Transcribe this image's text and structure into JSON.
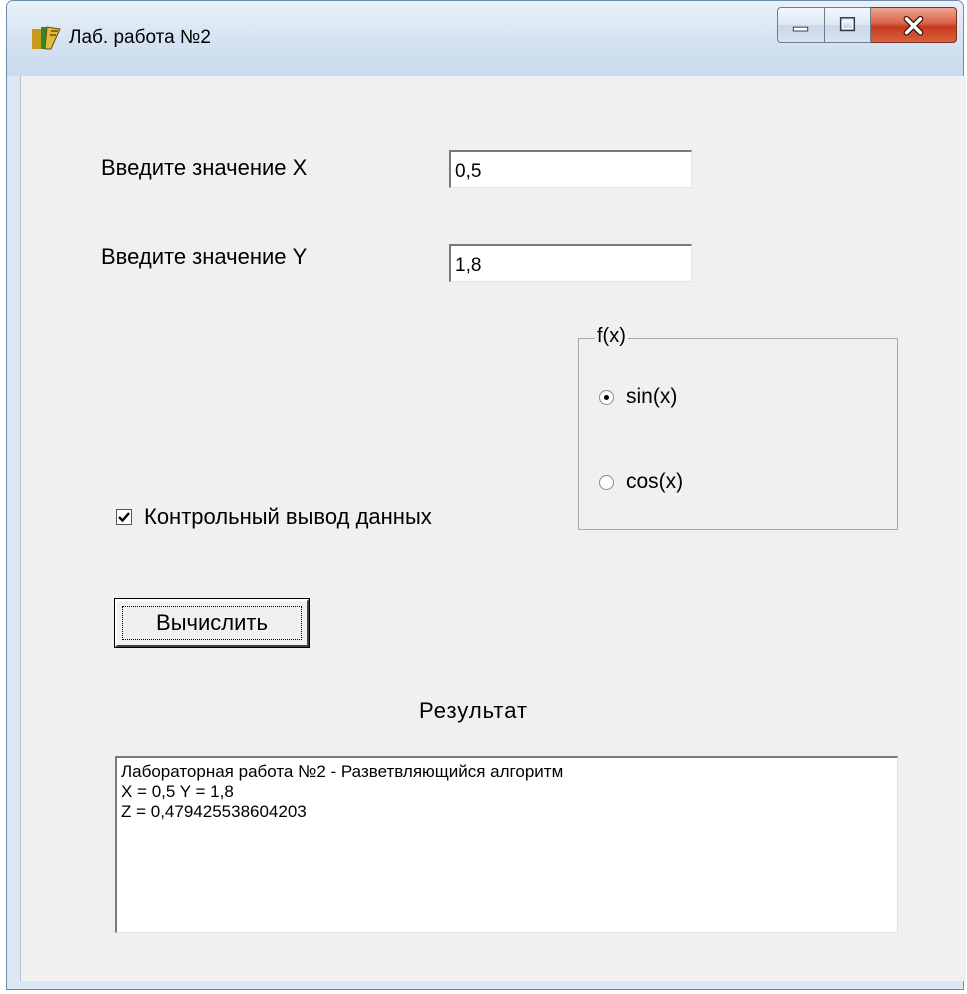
{
  "window": {
    "title": "Лаб. работа №2",
    "controls": [
      "minimize-icon",
      "maximize-icon",
      "close-icon"
    ]
  },
  "form": {
    "label_x": "Введите значение X",
    "input_x": "0,5",
    "label_y": "Введите значение Y",
    "input_y": "1,8",
    "group_caption": "f(x)",
    "radio_options": [
      {
        "label": "sin(x)",
        "checked": true
      },
      {
        "label": "cos(x)",
        "checked": false
      }
    ],
    "checkbox_label": "Контрольный вывод данных",
    "checkbox_checked": true,
    "compute_button": "Вычислить",
    "result_title": "Результат",
    "result_lines": [
      "Лабораторная работа №2 - Разветвляющийся алгоритм",
      "X = 0,5 Y = 1,8",
      "Z = 0,479425538604203"
    ]
  },
  "colors": {
    "client_bg": "#f0f0f0",
    "titlebar": "#dbe7f4",
    "close_button": "#c7391c"
  }
}
